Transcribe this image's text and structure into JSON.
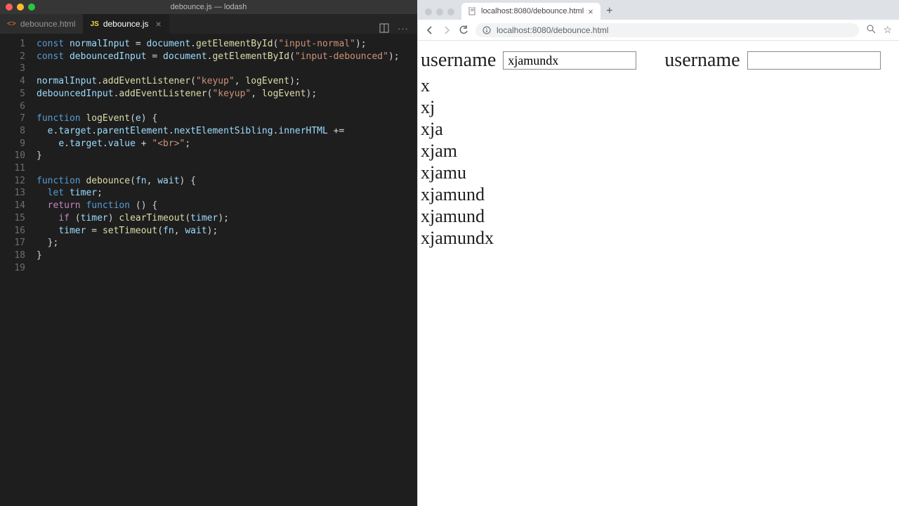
{
  "vscode": {
    "window_title": "debounce.js — lodash",
    "tabs": [
      {
        "label": "debounce.html",
        "icon": "<>"
      },
      {
        "label": "debounce.js",
        "icon": "JS"
      }
    ],
    "line_count": 19,
    "code_lines": {
      "l1": {
        "a": "const",
        "b": "normalInput",
        "c": " = ",
        "d": "document",
        "e": ".",
        "f": "getElementById",
        "g": "(",
        "h": "\"input-normal\"",
        "i": ");"
      },
      "l2": {
        "a": "const",
        "b": "debouncedInput",
        "c": " = ",
        "d": "document",
        "e": ".",
        "f": "getElementById",
        "g": "(",
        "h": "\"input-debounced\"",
        "i": ");"
      },
      "l4": {
        "a": "normalInput",
        "b": ".",
        "c": "addEventListener",
        "d": "(",
        "e": "\"keyup\"",
        "f": ", ",
        "g": "logEvent",
        "h": ");"
      },
      "l5": {
        "a": "debouncedInput",
        "b": ".",
        "c": "addEventListener",
        "d": "(",
        "e": "\"keyup\"",
        "f": ", ",
        "g": "logEvent",
        "h": ");"
      },
      "l7": {
        "a": "function",
        "b": "logEvent",
        "c": "(",
        "d": "e",
        "e": ") {"
      },
      "l8": {
        "a": "  ",
        "b": "e",
        "c": ".",
        "d": "target",
        "e": ".",
        "f": "parentElement",
        "g": ".",
        "h": "nextElementSibling",
        "i": ".",
        "j": "innerHTML",
        "k": " +="
      },
      "l9": {
        "a": "    ",
        "b": "e",
        "c": ".",
        "d": "target",
        "e": ".",
        "f": "value",
        "g": " + ",
        "h": "\"<br>\"",
        "i": ";"
      },
      "l10": {
        "a": "}"
      },
      "l12": {
        "a": "function",
        "b": "debounce",
        "c": "(",
        "d": "fn",
        "e": ", ",
        "f": "wait",
        "g": ") {"
      },
      "l13": {
        "a": "  ",
        "b": "let",
        "c": " ",
        "d": "timer",
        "e": ";"
      },
      "l14": {
        "a": "  ",
        "b": "return",
        "c": " ",
        "d": "function",
        "e": " () {"
      },
      "l15": {
        "a": "    ",
        "b": "if",
        "c": " (",
        "d": "timer",
        "e": ") ",
        "f": "clearTimeout",
        "g": "(",
        "h": "timer",
        "i": ");"
      },
      "l16": {
        "a": "    ",
        "b": "timer",
        "c": " = ",
        "d": "setTimeout",
        "e": "(",
        "f": "fn",
        "g": ", ",
        "h": "wait",
        "i": ");"
      },
      "l17": {
        "a": "  };"
      },
      "l18": {
        "a": "}"
      }
    }
  },
  "browser": {
    "tab_title": "localhost:8080/debounce.html",
    "url": "localhost:8080/debounce.html",
    "new_tab": "+",
    "left_label": "username",
    "left_input_value": "xjamundx",
    "right_label": "username",
    "right_input_value": "",
    "log_lines": [
      "x",
      "xj",
      "xja",
      "xjam",
      "xjamu",
      "xjamund",
      "xjamund",
      "xjamundx"
    ]
  }
}
